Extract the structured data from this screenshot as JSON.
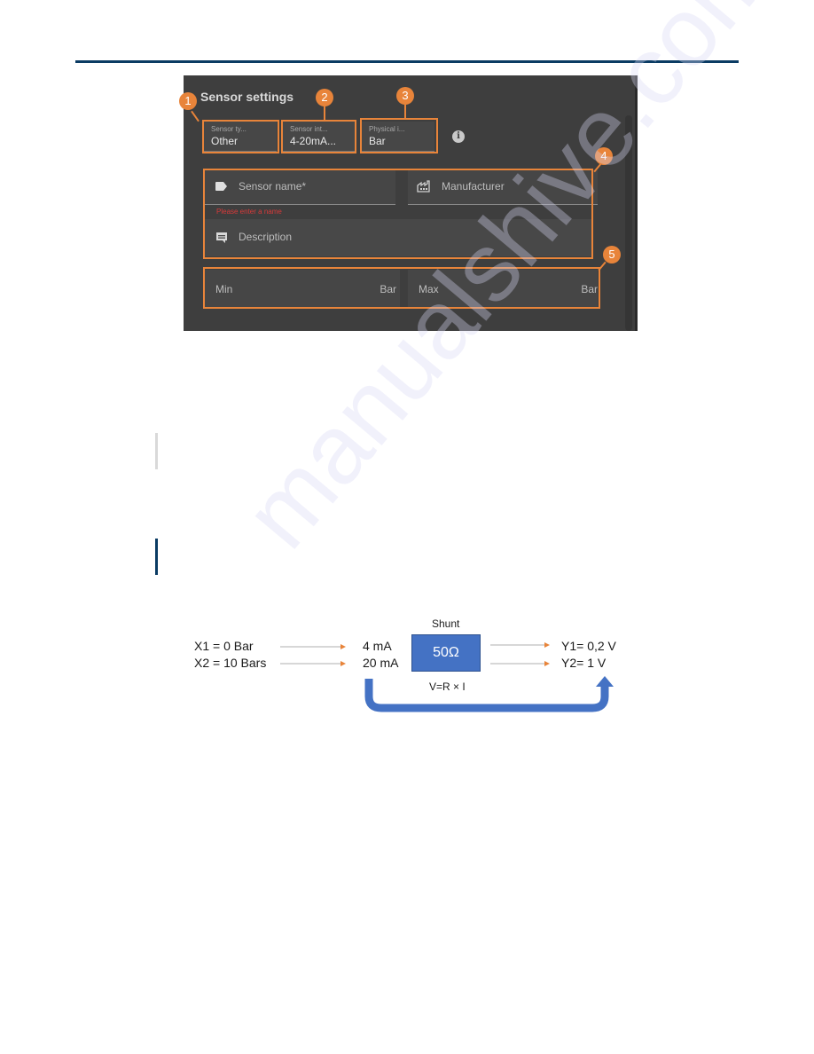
{
  "page": {
    "watermark": "manualshive.com"
  },
  "sensor_settings": {
    "title": "Sensor settings",
    "fields": [
      {
        "label": "Sensor ty...",
        "value": "Other",
        "badge": "1"
      },
      {
        "label": "Sensor int...",
        "value": "4-20mA...",
        "badge": "2"
      },
      {
        "label": "Physical i...",
        "value": "Bar",
        "badge": "3"
      }
    ],
    "info_icon": "i",
    "group4_badge": "4",
    "group5_badge": "5",
    "sensor_name_placeholder": "Sensor name*",
    "sensor_name_error": "Please enter a name",
    "manufacturer_placeholder": "Manufacturer",
    "description_placeholder": "Description",
    "min_label": "Min",
    "min_unit": "Bar",
    "max_label": "Max",
    "max_unit": "Bar"
  },
  "diagram": {
    "inputs": [
      "X1 = 0 Bar",
      "X2 = 10 Bars"
    ],
    "currents": [
      "4 mA",
      "20 mA"
    ],
    "shunt_label": "Shunt",
    "shunt_value": "50Ω",
    "formula": "V=R × I",
    "outputs": [
      "Y1= 0,2 V",
      "Y2= 1 V"
    ],
    "colors": {
      "arrow": "#e8843a",
      "shunt": "#4472c4",
      "flow": "#4472c4"
    }
  }
}
